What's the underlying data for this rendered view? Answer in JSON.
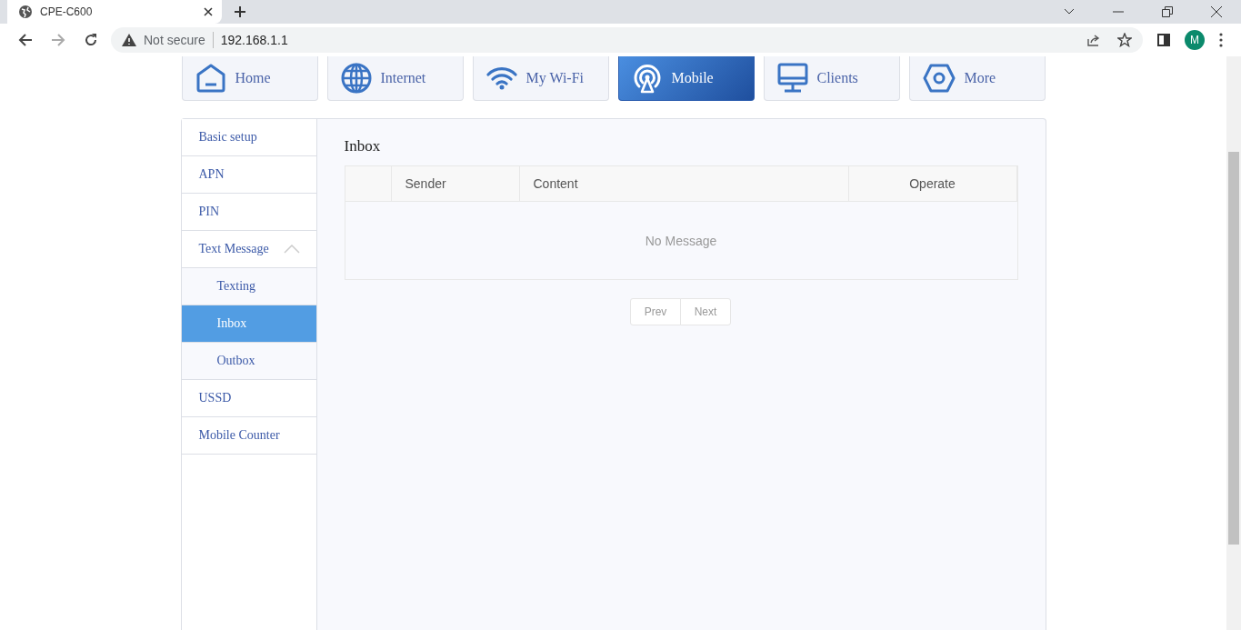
{
  "browser": {
    "tab_title": "CPE-C600",
    "security": "Not secure",
    "url": "192.168.1.1",
    "profile": "M"
  },
  "nav_tabs": [
    {
      "label": "Home",
      "kind": "home",
      "selected": false
    },
    {
      "label": "Internet",
      "kind": "globe",
      "selected": false
    },
    {
      "label": "My Wi-Fi",
      "kind": "wifi",
      "selected": false
    },
    {
      "label": "Mobile",
      "kind": "antenna",
      "selected": true
    },
    {
      "label": "Clients",
      "kind": "monitor",
      "selected": false
    },
    {
      "label": "More",
      "kind": "hexagon",
      "selected": false
    }
  ],
  "sidebar": {
    "items": [
      {
        "label": "Basic setup",
        "selected": false
      },
      {
        "label": "APN",
        "selected": false
      },
      {
        "label": "PIN",
        "selected": false
      },
      {
        "label": "Text Message",
        "selected": false,
        "expanded": true,
        "children": [
          {
            "label": "Texting",
            "selected": false
          },
          {
            "label": "Inbox",
            "selected": true
          },
          {
            "label": "Outbox",
            "selected": false
          }
        ]
      },
      {
        "label": "USSD",
        "selected": false
      },
      {
        "label": "Mobile Counter",
        "selected": false
      }
    ]
  },
  "page_title": "Inbox",
  "table": {
    "columns": [
      "Sender",
      "Content",
      "Operate"
    ],
    "empty_text": "No Message"
  },
  "pagination": [
    {
      "label": "Prev",
      "disabled": true
    },
    {
      "label": "Next",
      "disabled": true
    }
  ]
}
